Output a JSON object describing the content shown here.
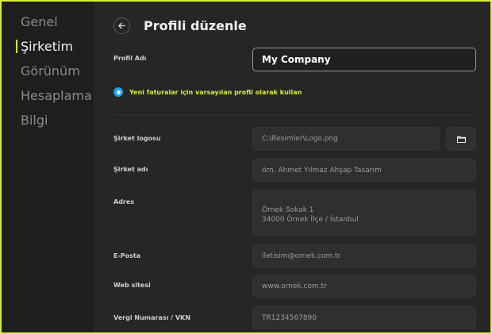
{
  "sidebar": {
    "items": [
      {
        "label": "Genel"
      },
      {
        "label": "Şirketim"
      },
      {
        "label": "Görünüm"
      },
      {
        "label": "Hesaplama"
      },
      {
        "label": "Bilgi"
      }
    ],
    "active_index": 1
  },
  "header": {
    "title": "Profili düzenle"
  },
  "form": {
    "profile_name_label": "Profil Adı",
    "profile_name_value": "My Company",
    "default_radio_label": "Yeni faturalar için varsayılan profil olarak kullan",
    "logo_label": "Şirket logosu",
    "logo_value": "C:\\Resimler\\Logo.png",
    "company_label": "Şirket adı",
    "company_placeholder": "örn. Ahmet Yılmaz Ahşap Tasarım",
    "address_label": "Adres",
    "address_line1": "Örnek Sokak 1",
    "address_line2": "34000 Örnek İlçe / İstanbul",
    "email_label": "E-Posta",
    "email_placeholder": "iletisim@ornek.com.tr",
    "web_label": "Web sitesi",
    "web_placeholder": "www.ornek.com.tr",
    "tax_label": "Vergi Numarası / VKN",
    "tax_placeholder": "TR1234567890"
  },
  "colors": {
    "accent": "#d9ea3a",
    "radio": "#1da1f2"
  },
  "icons": {
    "back": "arrow-left-icon",
    "folder": "folder-icon"
  }
}
